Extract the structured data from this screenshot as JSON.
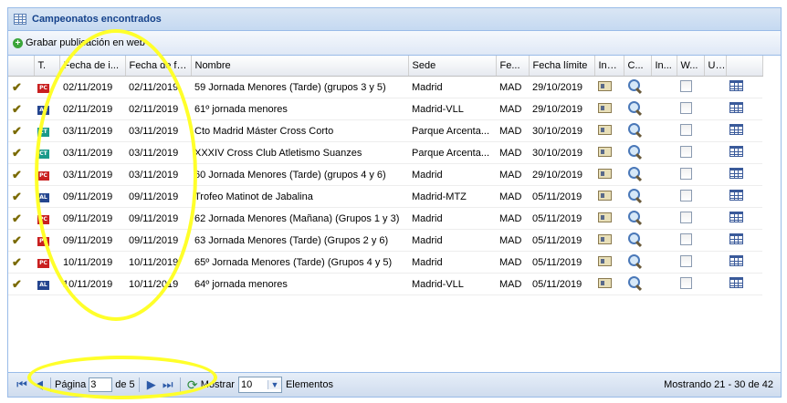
{
  "panel": {
    "title": "Campeonatos encontrados",
    "toolbar_button": "Grabar publicación en web"
  },
  "columns": [
    "",
    "T.",
    "Fecha de i...",
    "Fecha de fi...",
    "Nombre",
    "Sede",
    "Fe...",
    "Fecha límite",
    "Ins...",
    "C...",
    "In...",
    "W...",
    "U...",
    ""
  ],
  "rows": [
    {
      "check": "✔",
      "type": "PC",
      "start": "02/11/2019",
      "end": "02/11/2019",
      "name": "59 Jornada Menores (Tarde) (grupos 3 y 5)",
      "venue": "Madrid",
      "fed": "MAD",
      "deadline": "29/10/2019"
    },
    {
      "check": "✔",
      "type": "AL",
      "start": "02/11/2019",
      "end": "02/11/2019",
      "name": "61º jornada menores",
      "venue": "Madrid-VLL",
      "fed": "MAD",
      "deadline": "29/10/2019"
    },
    {
      "check": "✔",
      "type": "CT",
      "start": "03/11/2019",
      "end": "03/11/2019",
      "name": "Cto Madrid Máster Cross Corto",
      "venue": "Parque Arcenta...",
      "fed": "MAD",
      "deadline": "30/10/2019"
    },
    {
      "check": "✔",
      "type": "CT",
      "start": "03/11/2019",
      "end": "03/11/2019",
      "name": "XXXIV Cross Club Atletismo Suanzes",
      "venue": "Parque Arcenta...",
      "fed": "MAD",
      "deadline": "30/10/2019"
    },
    {
      "check": "✔",
      "type": "PC",
      "start": "03/11/2019",
      "end": "03/11/2019",
      "name": "60 Jornada Menores (Tarde) (grupos 4 y 6)",
      "venue": "Madrid",
      "fed": "MAD",
      "deadline": "29/10/2019"
    },
    {
      "check": "✔",
      "type": "AL",
      "start": "09/11/2019",
      "end": "09/11/2019",
      "name": "Trofeo Matinot de Jabalina",
      "venue": "Madrid-MTZ",
      "fed": "MAD",
      "deadline": "05/11/2019"
    },
    {
      "check": "✔",
      "type": "PC",
      "start": "09/11/2019",
      "end": "09/11/2019",
      "name": "62 Jornada Menores (Mañana) (Grupos 1 y 3)",
      "venue": "Madrid",
      "fed": "MAD",
      "deadline": "05/11/2019"
    },
    {
      "check": "✔",
      "type": "PC",
      "start": "09/11/2019",
      "end": "09/11/2019",
      "name": "63 Jornada Menores (Tarde) (Grupos 2 y 6)",
      "venue": "Madrid",
      "fed": "MAD",
      "deadline": "05/11/2019"
    },
    {
      "check": "✔",
      "type": "PC",
      "start": "10/11/2019",
      "end": "10/11/2019",
      "name": "65º Jornada Menores (Tarde) (Grupos 4 y 5)",
      "venue": "Madrid",
      "fed": "MAD",
      "deadline": "05/11/2019"
    },
    {
      "check": "✔",
      "type": "AL",
      "start": "10/11/2019",
      "end": "10/11/2019",
      "name": "64º jornada menores",
      "venue": "Madrid-VLL",
      "fed": "MAD",
      "deadline": "05/11/2019"
    }
  ],
  "pager": {
    "page_label": "Página",
    "page_value": "3",
    "of_label": "de 5",
    "show_label": "Mostrar",
    "page_size": "10",
    "items_label": "Elementos",
    "info": "Mostrando 21 - 30 de 42"
  },
  "colors": {
    "annotation": "#ffff2a",
    "header_text": "#15428b"
  }
}
